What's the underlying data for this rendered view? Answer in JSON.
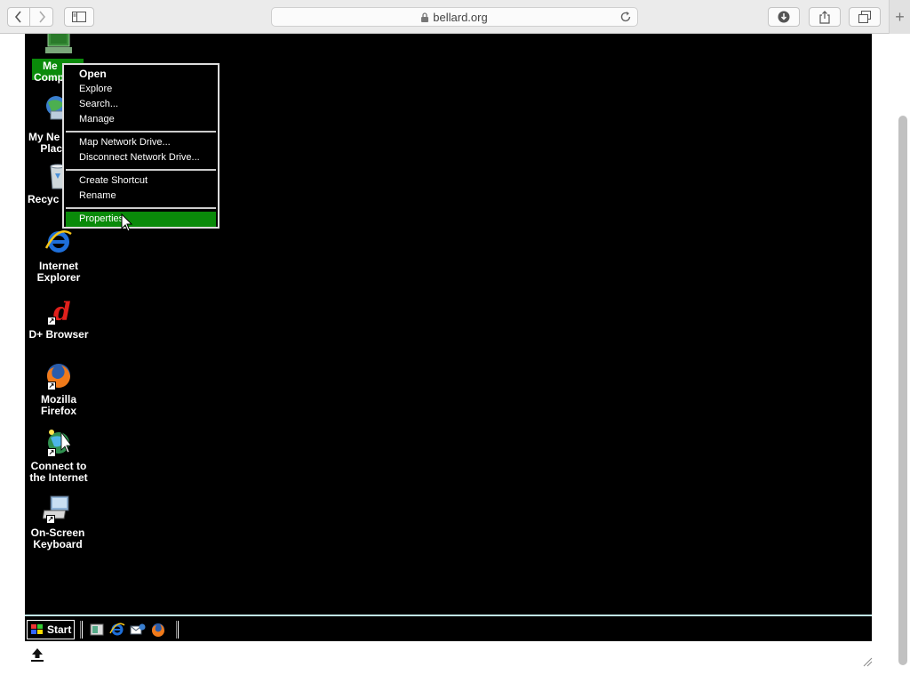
{
  "browser": {
    "url": "bellard.org",
    "new_tab": "+"
  },
  "desktop": {
    "icons": [
      {
        "name": "my-computer",
        "label": "My Computer",
        "label_visible": "Me\nComp"
      },
      {
        "name": "my-network-places",
        "label": "My Network Places",
        "label_visible": "My Ne\nPlac"
      },
      {
        "name": "recycle-bin",
        "label": "Recycle Bin",
        "label_visible": "Recyc"
      },
      {
        "name": "internet-explorer",
        "label_line1": "Internet",
        "label_line2": "Explorer"
      },
      {
        "name": "d-plus-browser",
        "label_line1": "D+ Browser"
      },
      {
        "name": "mozilla-firefox",
        "label_line1": "Mozilla",
        "label_line2": "Firefox"
      },
      {
        "name": "connect-to-internet",
        "label_line1": "Connect to",
        "label_line2": "the Internet"
      },
      {
        "name": "on-screen-keyboard",
        "label_line1": "On-Screen",
        "label_line2": "Keyboard"
      }
    ]
  },
  "context_menu": {
    "group1": [
      "Open",
      "Explore",
      "Search...",
      "Manage"
    ],
    "group2": [
      "Map Network Drive...",
      "Disconnect Network Drive..."
    ],
    "group3": [
      "Create Shortcut",
      "Rename"
    ],
    "group4": [
      "Properties"
    ],
    "selected": "Properties"
  },
  "taskbar": {
    "start_label": "Start"
  },
  "colors": {
    "selection": "#0a8a0a",
    "desktop_bg": "#000000",
    "taskbar_border": "#bfe5e5"
  }
}
